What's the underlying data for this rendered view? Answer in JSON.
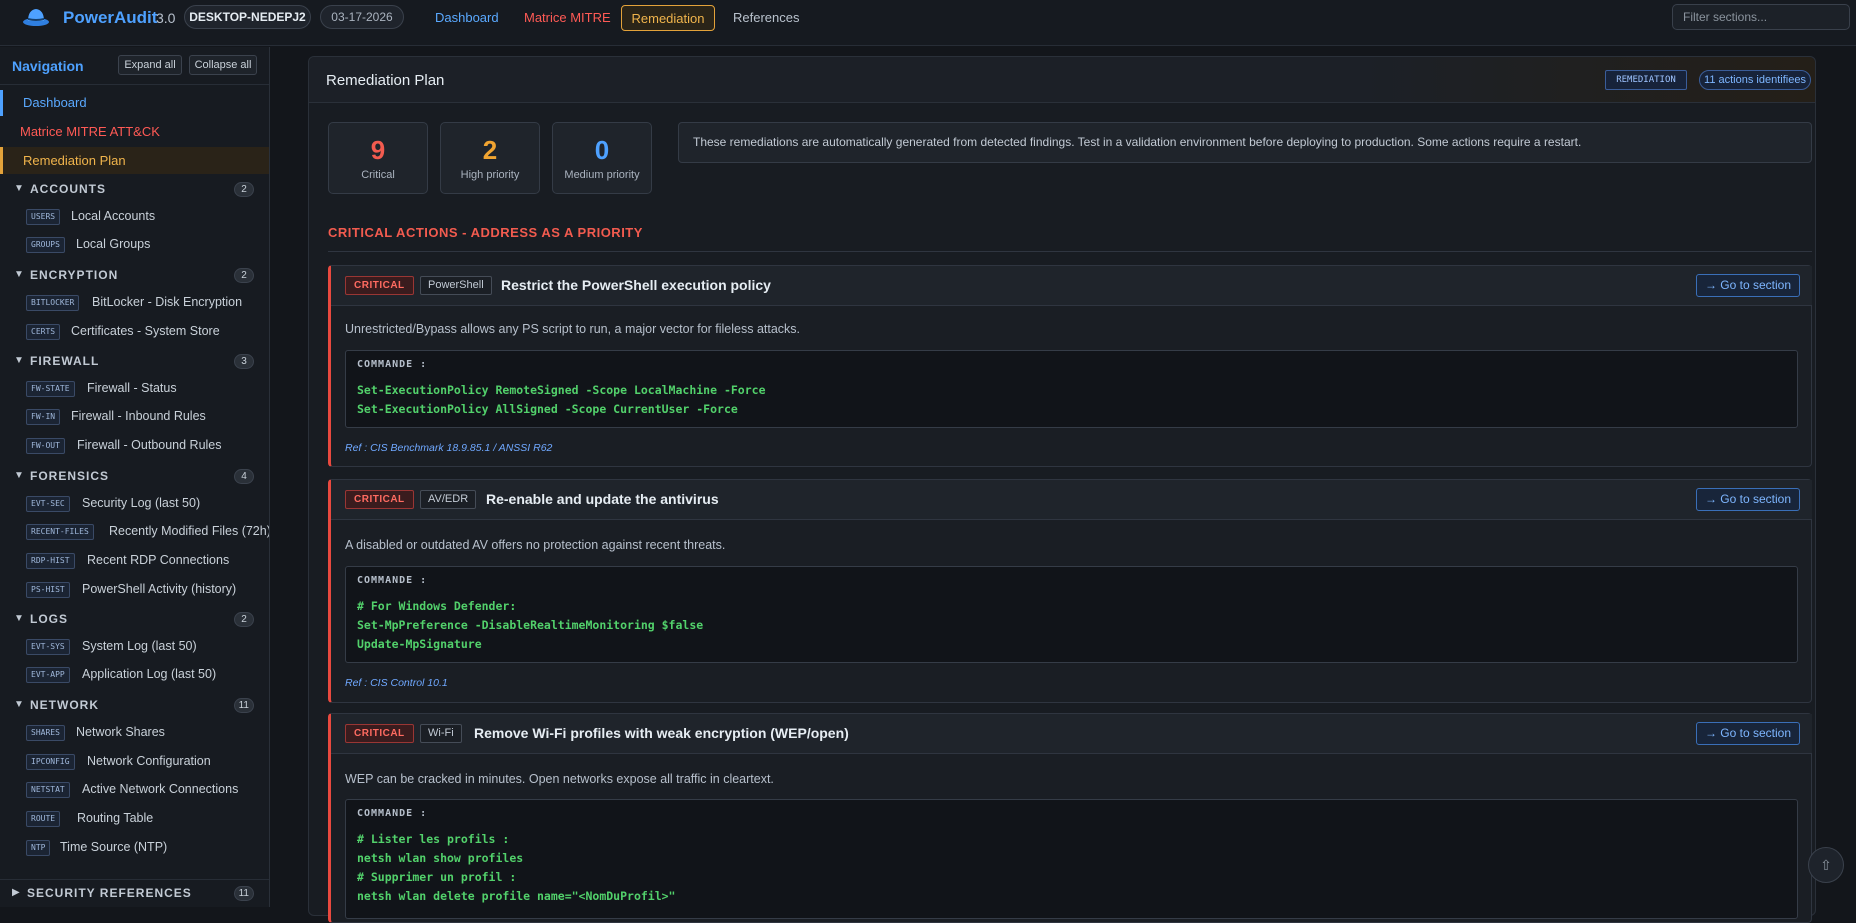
{
  "app": {
    "name": "PowerAudit",
    "version": "3.0",
    "host": "DESKTOP-NEDEPJ2",
    "date": "03-17-2026"
  },
  "topnav": {
    "dashboard": "Dashboard",
    "mitre": "Matrice MITRE",
    "remediation": "Remediation",
    "references": "References"
  },
  "filter": {
    "placeholder": "Filter sections..."
  },
  "sidebar": {
    "title": "Navigation",
    "expand_all": "Expand all",
    "collapse_all": "Collapse all",
    "links": {
      "dashboard": "Dashboard",
      "mitre": "Matrice MITRE ATT&CK",
      "remediation": "Remediation Plan"
    },
    "groups": {
      "accounts": {
        "name": "ACCOUNTS",
        "count": "2",
        "items": [
          {
            "tag": "USERS",
            "label": "Local Accounts"
          },
          {
            "tag": "GROUPS",
            "label": "Local Groups"
          }
        ]
      },
      "encryption": {
        "name": "ENCRYPTION",
        "count": "2",
        "items": [
          {
            "tag": "BITLOCKER",
            "label": "BitLocker - Disk Encryption"
          },
          {
            "tag": "CERTS",
            "label": "Certificates - System Store"
          }
        ]
      },
      "firewall": {
        "name": "FIREWALL",
        "count": "3",
        "items": [
          {
            "tag": "FW-STATE",
            "label": "Firewall - Status"
          },
          {
            "tag": "FW-IN",
            "label": "Firewall - Inbound Rules"
          },
          {
            "tag": "FW-OUT",
            "label": "Firewall - Outbound Rules"
          }
        ]
      },
      "forensics": {
        "name": "FORENSICS",
        "count": "4",
        "items": [
          {
            "tag": "EVT-SEC",
            "label": "Security Log (last 50)"
          },
          {
            "tag": "RECENT-FILES",
            "label": "Recently Modified Files (72h)"
          },
          {
            "tag": "RDP-HIST",
            "label": "Recent RDP Connections"
          },
          {
            "tag": "PS-HIST",
            "label": "PowerShell Activity (history)"
          }
        ]
      },
      "logs": {
        "name": "LOGS",
        "count": "2",
        "items": [
          {
            "tag": "EVT-SYS",
            "label": "System Log (last 50)"
          },
          {
            "tag": "EVT-APP",
            "label": "Application Log (last 50)"
          }
        ]
      },
      "network": {
        "name": "NETWORK",
        "count": "11",
        "items": [
          {
            "tag": "SHARES",
            "label": "Network Shares"
          },
          {
            "tag": "IPCONFIG",
            "label": "Network Configuration"
          },
          {
            "tag": "NETSTAT",
            "label": "Active Network Connections"
          },
          {
            "tag": "ROUTE",
            "label": "Routing Table"
          },
          {
            "tag": "NTP",
            "label": "Time Source (NTP)"
          }
        ]
      },
      "secrefs": {
        "name": "SECURITY REFERENCES",
        "count": "11"
      }
    }
  },
  "main": {
    "title": "Remediation Plan",
    "badge": "REMEDIATION",
    "actions_count": "11 actions identifiees",
    "stats": [
      {
        "value": "9",
        "label": "Critical",
        "color": "#f25b4f"
      },
      {
        "value": "2",
        "label": "High priority",
        "color": "#f0a431"
      },
      {
        "value": "0",
        "label": "Medium priority",
        "color": "#4ea1ff"
      }
    ],
    "info": "These remediations are automatically generated from detected findings. Test in a validation environment before deploying to production. Some actions require a restart.",
    "section_title": "CRITICAL ACTIONS - ADDRESS AS A PRIORITY",
    "goto_label": "→ Go to section",
    "code_label": "COMMANDE :",
    "cards": [
      {
        "severity": "CRITICAL",
        "category": "PowerShell",
        "title": "Restrict the PowerShell execution policy",
        "desc": "Unrestricted/Bypass allows any PS script to run, a major vector for fileless attacks.",
        "code": [
          "Set-ExecutionPolicy RemoteSigned -Scope LocalMachine -Force",
          "Set-ExecutionPolicy AllSigned -Scope CurrentUser -Force"
        ],
        "ref": "Ref : CIS Benchmark 18.9.85.1 / ANSSI R62"
      },
      {
        "severity": "CRITICAL",
        "category": "AV/EDR",
        "title": "Re-enable and update the antivirus",
        "desc": "A disabled or outdated AV offers no protection against recent threats.",
        "code": [
          "# For Windows Defender:",
          "Set-MpPreference -DisableRealtimeMonitoring $false",
          "Update-MpSignature"
        ],
        "ref": "Ref : CIS Control 10.1"
      },
      {
        "severity": "CRITICAL",
        "category": "Wi-Fi",
        "title": "Remove Wi-Fi profiles with weak encryption (WEP/open)",
        "desc": "WEP can be cracked in minutes. Open networks expose all traffic in cleartext.",
        "code": [
          "# Lister les profils :",
          "netsh wlan show profiles",
          "# Supprimer un profil :",
          "netsh wlan delete profile name=\"<NomDuProfil>\""
        ]
      }
    ]
  }
}
